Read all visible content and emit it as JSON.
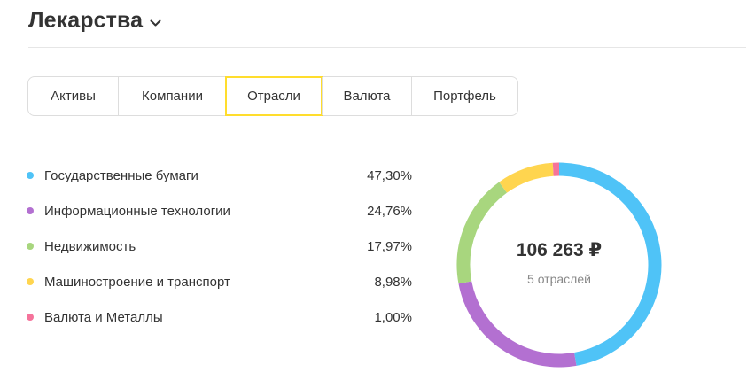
{
  "header": {
    "title": "Лекарства"
  },
  "tabs": [
    {
      "label": "Активы",
      "active": false
    },
    {
      "label": "Компании",
      "active": false
    },
    {
      "label": "Отрасли",
      "active": true
    },
    {
      "label": "Валюта",
      "active": false
    },
    {
      "label": "Портфель",
      "active": false
    }
  ],
  "sectors": [
    {
      "name": "Государственные бумаги",
      "percent": "47,30%",
      "color": "#4fc3f7",
      "value": 47.3
    },
    {
      "name": "Информационные технологии",
      "percent": "24,76%",
      "color": "#b370d1",
      "value": 24.76
    },
    {
      "name": "Недвижимость",
      "percent": "17,97%",
      "color": "#a8d67e",
      "value": 17.97
    },
    {
      "name": "Машиностроение и транспорт",
      "percent": "8,98%",
      "color": "#ffd54f",
      "value": 8.98
    },
    {
      "name": "Валюта и Металлы",
      "percent": "1,00%",
      "color": "#f5739b",
      "value": 1.0
    }
  ],
  "summary": {
    "total": "106 263 ₽",
    "count_label": "5 отраслей"
  },
  "colors": {
    "accent": "#ffdd2d"
  },
  "chart_data": {
    "type": "pie",
    "categories": [
      "Государственные бумаги",
      "Информационные технологии",
      "Недвижимость",
      "Машиностроение и транспорт",
      "Валюта и Металлы"
    ],
    "values": [
      47.3,
      24.76,
      17.97,
      8.98,
      1.0
    ],
    "colors": [
      "#4fc3f7",
      "#b370d1",
      "#a8d67e",
      "#ffd54f",
      "#f5739b"
    ]
  }
}
